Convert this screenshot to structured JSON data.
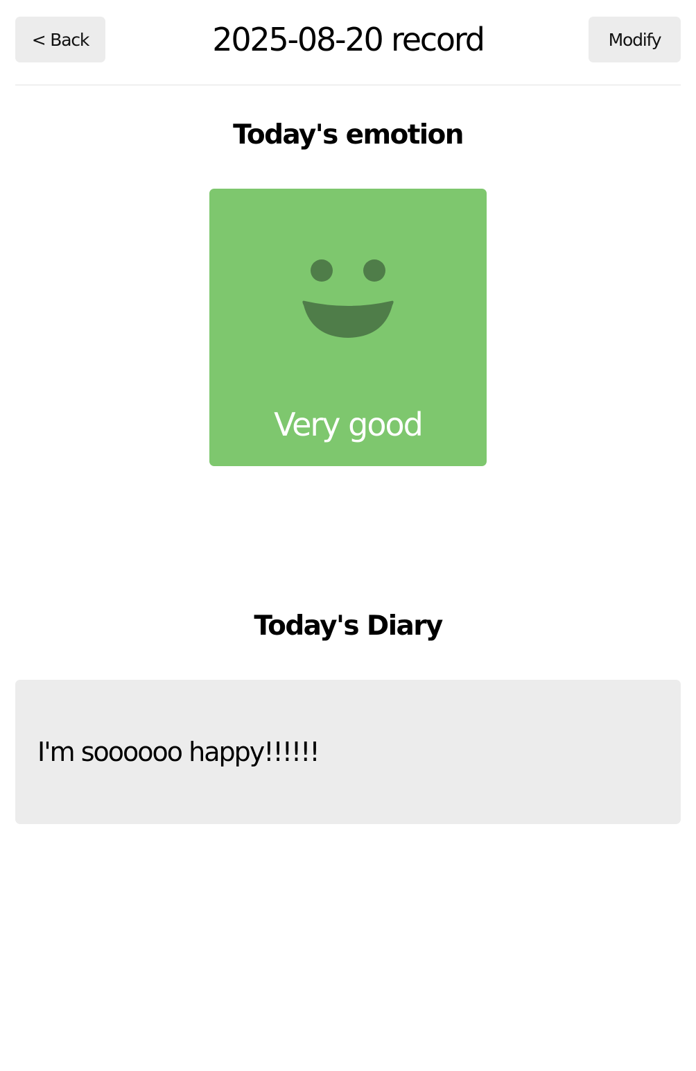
{
  "header": {
    "back_label": "< Back",
    "title": "2025-08-20 record",
    "modify_label": "Modify"
  },
  "emotion_section": {
    "title": "Today's emotion",
    "emotion_label": "Very good",
    "emotion_icon": "smiling-face-icon",
    "card_color": "#7ec76e",
    "face_color": "#4f7d49"
  },
  "diary_section": {
    "title": "Today's Diary",
    "content": "I'm soooooo happy!!!!!!"
  }
}
